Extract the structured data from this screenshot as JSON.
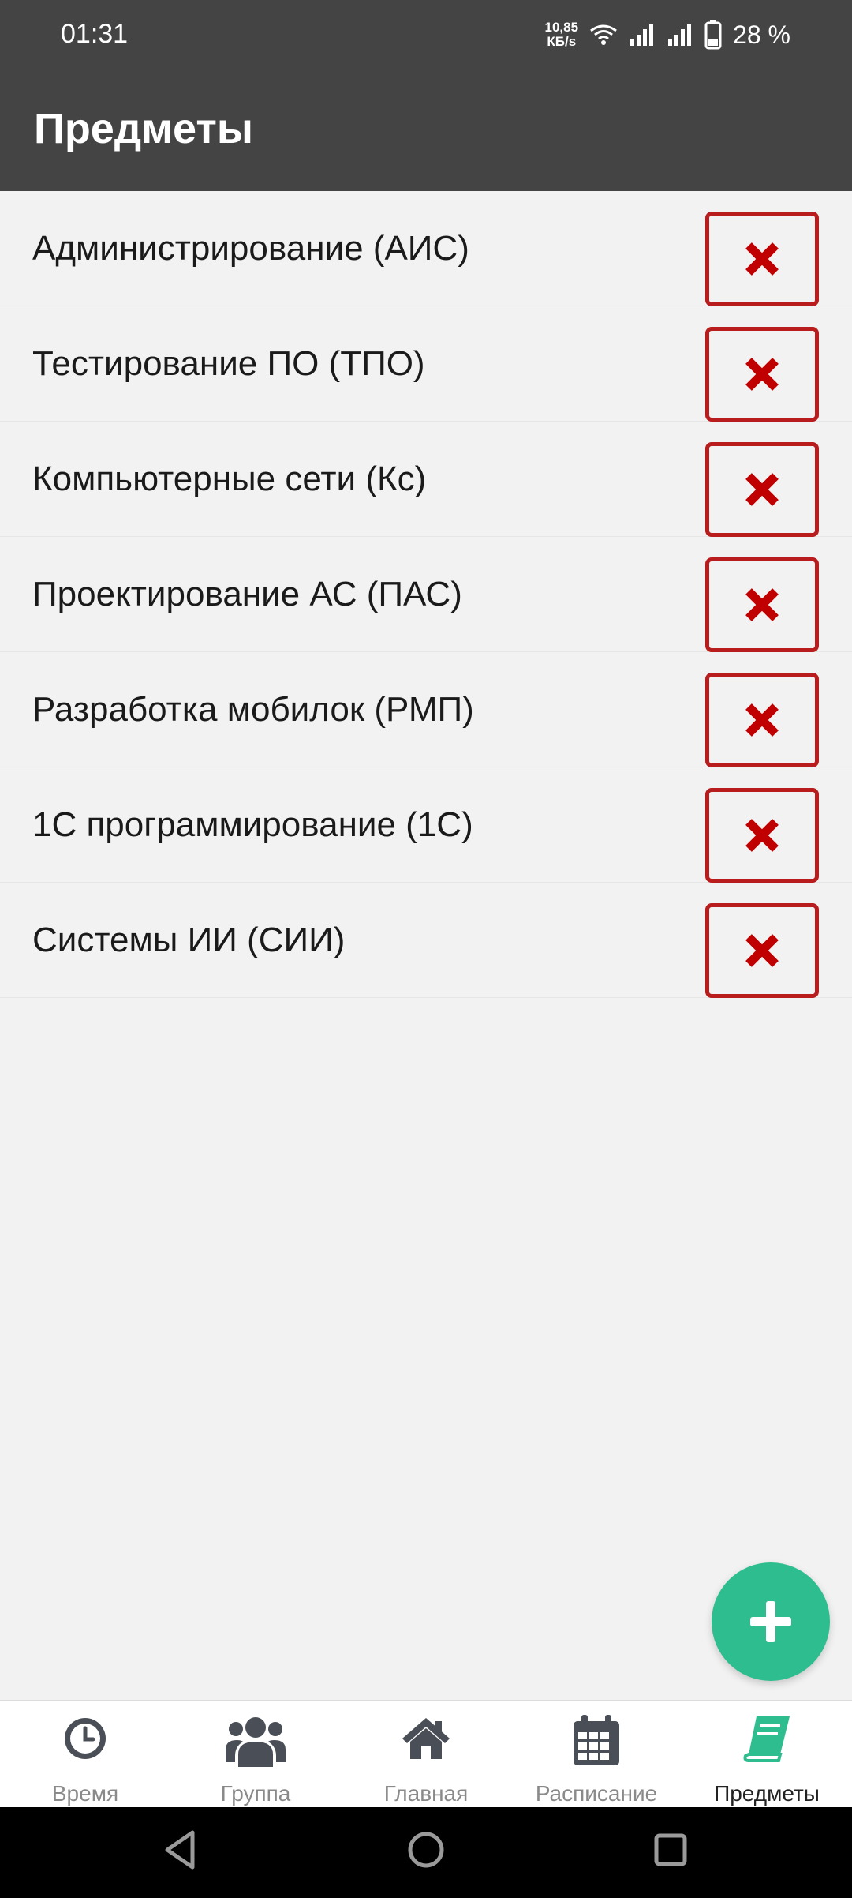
{
  "status_bar": {
    "time": "01:31",
    "net_speed_value": "10,85",
    "net_speed_unit": "КБ/s",
    "battery": "28 %"
  },
  "app_bar": {
    "title": "Предметы"
  },
  "subjects": [
    {
      "name": "Администрирование (АИС)"
    },
    {
      "name": "Тестирование ПО (ТПО)"
    },
    {
      "name": "Компьютерные сети (Кс)"
    },
    {
      "name": "Проектирование АС (ПАС)"
    },
    {
      "name": "Разработка мобилок (РМП)"
    },
    {
      "name": "1С программирование (1С)"
    },
    {
      "name": "Системы ИИ (СИИ)"
    }
  ],
  "fab": {
    "icon": "plus-icon"
  },
  "bottom_nav": [
    {
      "label": "Время",
      "icon": "clock-icon",
      "active": false
    },
    {
      "label": "Группа",
      "icon": "group-icon",
      "active": false
    },
    {
      "label": "Главная",
      "icon": "home-icon",
      "active": false
    },
    {
      "label": "Расписание",
      "icon": "calendar-icon",
      "active": false
    },
    {
      "label": "Предметы",
      "icon": "book-icon",
      "active": true
    }
  ],
  "colors": {
    "header": "#444444",
    "delete_red": "#b81c1c",
    "accent_green": "#2ebd8e",
    "nav_inactive": "#8a8a8a"
  }
}
